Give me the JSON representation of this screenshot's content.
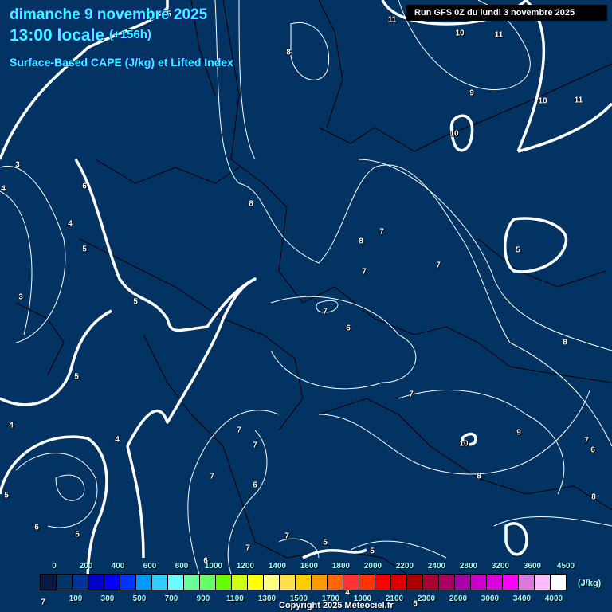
{
  "header": {
    "date": "dimanche 9 novembre 2025",
    "time": "13:00 locale",
    "lead": "(+156h)",
    "title": "Surface-Based CAPE (J/kg) et Lifted Index",
    "run": "Run GFS 0Z du lundi 3 novembre 2025"
  },
  "colors": {
    "background": "#023363",
    "contour": "#ffffff",
    "borders": "#000000",
    "title": "#33ffff"
  },
  "map": {
    "contour_labels": [
      "5",
      "11",
      "10",
      "11",
      "8",
      "9",
      "10",
      "11",
      "10",
      "3",
      "4",
      "6",
      "8",
      "4",
      "5",
      "8",
      "7",
      "7",
      "5",
      "3",
      "5",
      "7",
      "7",
      "6",
      "8",
      "5",
      "7",
      "4",
      "4",
      "7",
      "7",
      "10",
      "9",
      "7",
      "6",
      "6",
      "8",
      "8",
      "5",
      "6",
      "5",
      "7",
      "7",
      "5",
      "5",
      "7",
      "6",
      "6",
      "7",
      "4"
    ]
  },
  "colorbar": {
    "unit": "(J/kg)",
    "swatches": [
      "#0a1845",
      "#003366",
      "#003399",
      "#0000cc",
      "#0000ff",
      "#0033ff",
      "#0099ff",
      "#33ccff",
      "#66ffff",
      "#66ff99",
      "#66ff66",
      "#66ff00",
      "#ccff11",
      "#ffff00",
      "#ffff80",
      "#ffe24a",
      "#ffcc00",
      "#ff9900",
      "#ff6600",
      "#ff3333",
      "#ff3300",
      "#ff0000",
      "#dd0000",
      "#aa0000",
      "#aa0033",
      "#aa0066",
      "#aa00aa",
      "#cc00cc",
      "#dd00dd",
      "#ff00ff",
      "#dd77dd",
      "#ffbbff",
      "#ffffff"
    ],
    "top_labels": [
      "0",
      "200",
      "400",
      "600",
      "800",
      "1000",
      "1200",
      "1400",
      "1600",
      "1800",
      "2000",
      "2200",
      "2400",
      "2800",
      "3200",
      "3600",
      "4500"
    ],
    "bottom_labels": [
      "100",
      "300",
      "500",
      "700",
      "900",
      "1100",
      "1300",
      "1500",
      "1700",
      "1900",
      "2100",
      "2300",
      "2600",
      "3000",
      "3400",
      "4000"
    ]
  },
  "footer": {
    "copyright": "Copyright 2025 Meteociel.fr"
  }
}
